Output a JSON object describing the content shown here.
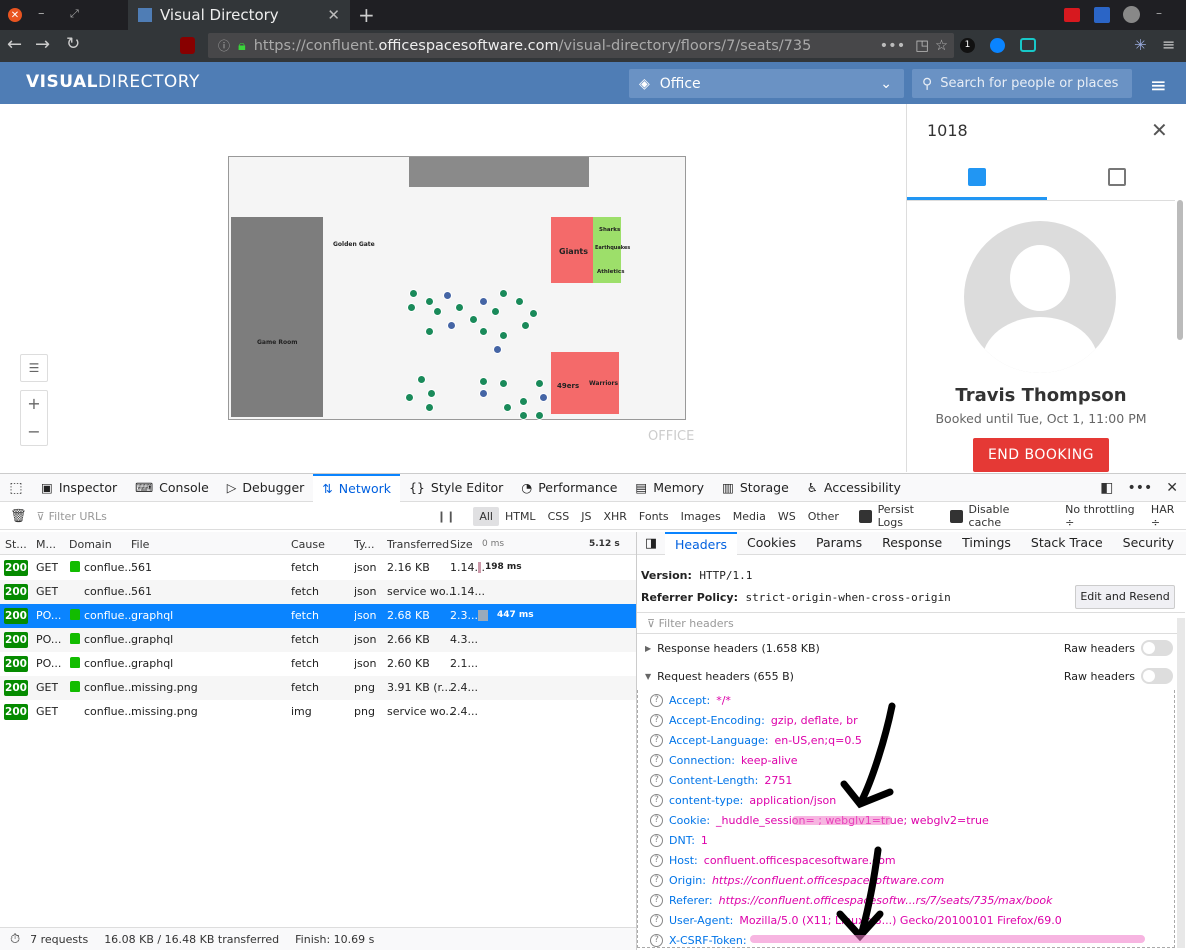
{
  "browser": {
    "tab_title": "Visual Directory",
    "url_pre": "https://confluent.",
    "url_domain": "officespacesoftware.com",
    "url_path": "/visual-directory/floors/7/seats/735"
  },
  "app": {
    "logo_bold": "VISUAL",
    "logo_light": "DIRECTORY",
    "office_select": "Office",
    "search_placeholder": "Search for people or places"
  },
  "map": {
    "rooms": [
      "Golden Gate",
      "Giants",
      "Sharks",
      "Earthquakes",
      "Athletics",
      "Game Room",
      "49ers",
      "Warriors"
    ],
    "watermark": "OFFICE"
  },
  "panel": {
    "seat": "1018",
    "name": "Travis Thompson",
    "booked": "Booked until Tue, Oct 1, 11:00 PM",
    "end_button": "END BOOKING"
  },
  "devtools": {
    "tabs": [
      "Inspector",
      "Console",
      "Debugger",
      "Network",
      "Style Editor",
      "Performance",
      "Memory",
      "Storage",
      "Accessibility"
    ],
    "filter_placeholder": "Filter URLs",
    "types": [
      "All",
      "HTML",
      "CSS",
      "JS",
      "XHR",
      "Fonts",
      "Images",
      "Media",
      "WS",
      "Other"
    ],
    "persist_logs": "Persist Logs",
    "disable_cache": "Disable cache",
    "throttling": "No throttling ÷",
    "har": "HAR ÷",
    "columns": [
      "St...",
      "M...",
      "Domain",
      "File",
      "Cause",
      "Ty...",
      "Transferred",
      "Size",
      "0 ms"
    ],
    "timeline_label": "5.12 s",
    "requests": [
      {
        "status": "200",
        "method": "GET",
        "lock": true,
        "domain": "conflue...",
        "file": "561",
        "cause": "fetch",
        "type": "json",
        "transferred": "2.16 KB",
        "size": "1.14...",
        "time": "198 ms"
      },
      {
        "status": "200",
        "method": "GET",
        "lock": false,
        "domain": "conflue...",
        "file": "561",
        "cause": "fetch",
        "type": "json",
        "transferred": "service wo...",
        "size": "1.14...",
        "time": ""
      },
      {
        "status": "200",
        "method": "PO...",
        "lock": true,
        "domain": "conflue...",
        "file": "graphql",
        "cause": "fetch",
        "type": "json",
        "transferred": "2.68 KB",
        "size": "2.3...",
        "time": "447 ms"
      },
      {
        "status": "200",
        "method": "PO...",
        "lock": true,
        "domain": "conflue...",
        "file": "graphql",
        "cause": "fetch",
        "type": "json",
        "transferred": "2.66 KB",
        "size": "4.3...",
        "time": ""
      },
      {
        "status": "200",
        "method": "PO...",
        "lock": true,
        "domain": "conflue...",
        "file": "graphql",
        "cause": "fetch",
        "type": "json",
        "transferred": "2.60 KB",
        "size": "2.1...",
        "time": ""
      },
      {
        "status": "200",
        "method": "GET",
        "lock": true,
        "domain": "conflue...",
        "file": "missing.png",
        "cause": "fetch",
        "type": "png",
        "transferred": "3.91 KB (r...",
        "size": "2.4...",
        "time": ""
      },
      {
        "status": "200",
        "method": "GET",
        "lock": false,
        "domain": "conflue...",
        "file": "missing.png",
        "cause": "img",
        "type": "png",
        "transferred": "service wo...",
        "size": "2.4...",
        "time": ""
      }
    ],
    "status_requests": "7 requests",
    "status_transferred": "16.08 KB / 16.48 KB transferred",
    "status_finish": "Finish: 10.69 s",
    "detail_tabs": [
      "Headers",
      "Cookies",
      "Params",
      "Response",
      "Timings",
      "Stack Trace",
      "Security"
    ],
    "version_label": "Version:",
    "version_value": "HTTP/1.1",
    "referrer_label": "Referrer Policy:",
    "referrer_value": "strict-origin-when-cross-origin",
    "edit_resend": "Edit and Resend",
    "filter_headers": "Filter headers",
    "response_headers": "Response headers (1.658 KB)",
    "request_headers": "Request headers (655 B)",
    "raw_headers": "Raw headers",
    "headers": [
      {
        "k": "Accept:",
        "v": "*/*"
      },
      {
        "k": "Accept-Encoding:",
        "v": "gzip, deflate, br"
      },
      {
        "k": "Accept-Language:",
        "v": "en-US,en;q=0.5"
      },
      {
        "k": "Connection:",
        "v": "keep-alive"
      },
      {
        "k": "Content-Length:",
        "v": "2751"
      },
      {
        "k": "content-type:",
        "v": "application/json"
      },
      {
        "k": "Cookie:",
        "v": "_huddle_session=                       ; webglv1=true; webglv2=true"
      },
      {
        "k": "DNT:",
        "v": "1"
      },
      {
        "k": "Host:",
        "v": "confluent.officespacesoftware.com"
      },
      {
        "k": "Origin:",
        "v": "https://confluent.officespacesoftware.com"
      },
      {
        "k": "Referer:",
        "v": "https://confluent.officespacesoftw...rs/7/seats/735/max/book"
      },
      {
        "k": "User-Agent:",
        "v": "Mozilla/5.0 (X11; Linux x8...) Gecko/20100101 Firefox/69.0"
      },
      {
        "k": "X-CSRF-Token:",
        "v": ""
      }
    ]
  }
}
